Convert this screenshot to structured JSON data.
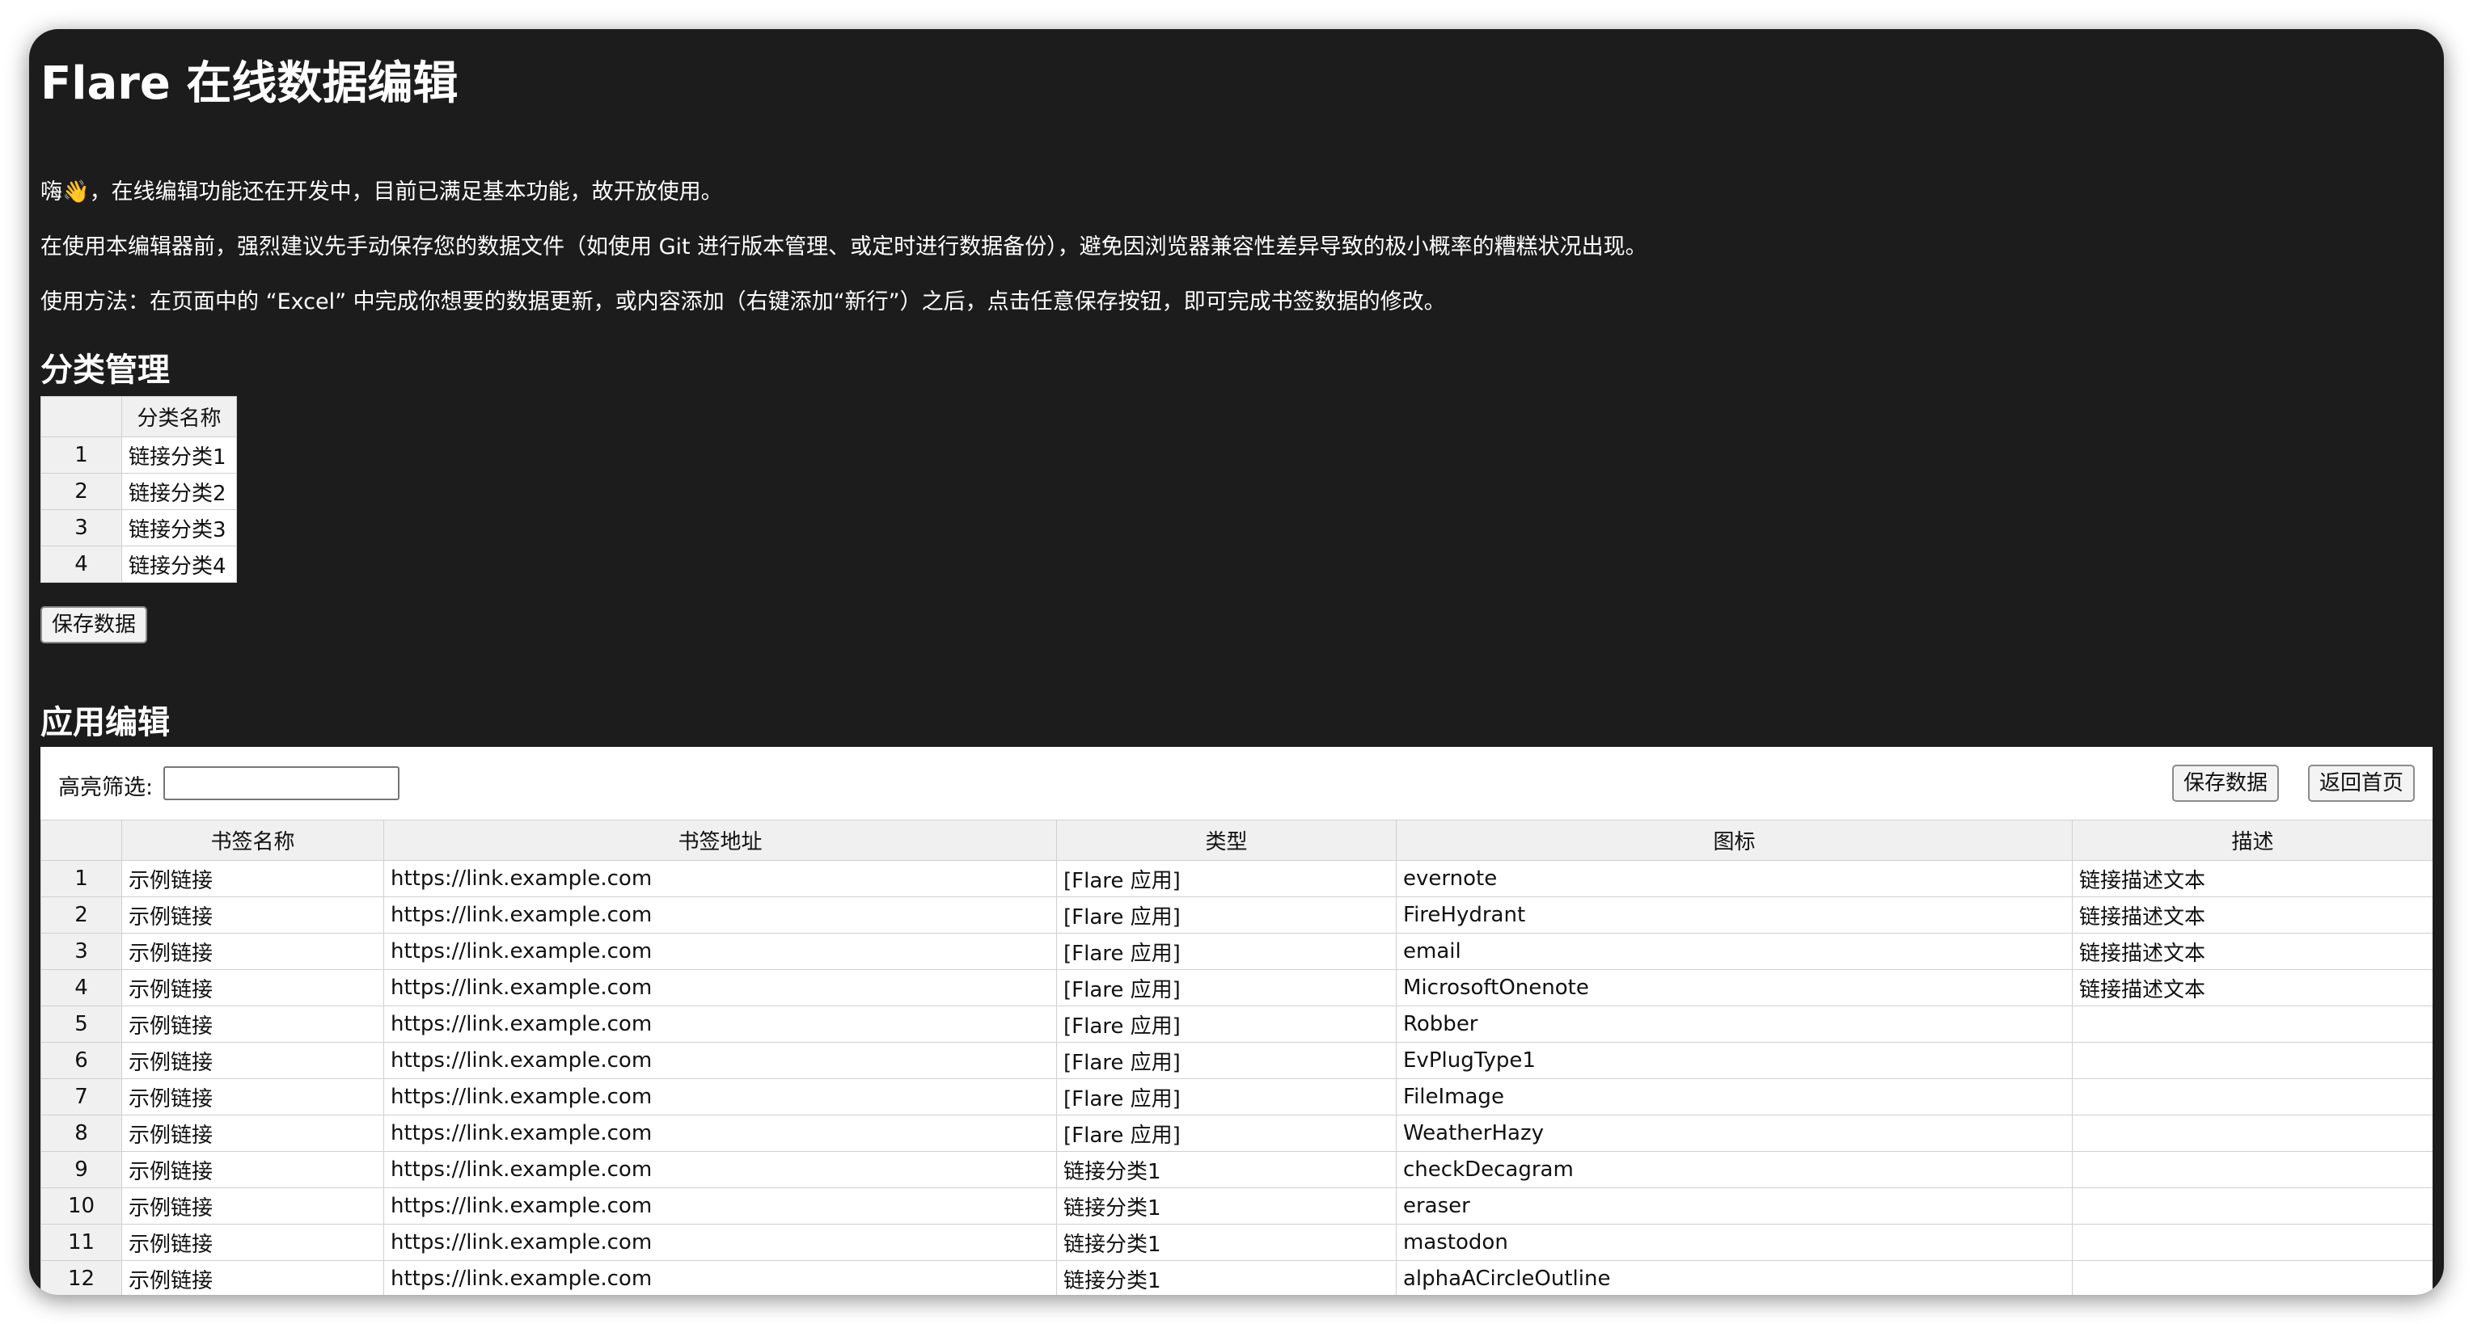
{
  "title": "Flare 在线数据编辑",
  "paragraphs": [
    "嗨👋，在线编辑功能还在开发中，目前已满足基本功能，故开放使用。",
    "在使用本编辑器前，强烈建议先手动保存您的数据文件（如使用 Git 进行版本管理、或定时进行数据备份），避免因浏览器兼容性差异导致的极小概率的糟糕状况出现。",
    "使用方法：在页面中的 “Excel” 中完成你想要的数据更新，或内容添加（右键添加“新行”）之后，点击任意保存按钮，即可完成书签数据的修改。"
  ],
  "categories": {
    "heading": "分类管理",
    "column_header": "分类名称",
    "rows": [
      {
        "num": "1",
        "name": "链接分类1"
      },
      {
        "num": "2",
        "name": "链接分类2"
      },
      {
        "num": "3",
        "name": "链接分类3"
      },
      {
        "num": "4",
        "name": "链接分类4"
      }
    ],
    "save_label": "保存数据"
  },
  "apps": {
    "heading": "应用编辑",
    "filter_label": "高亮筛选:",
    "filter_value": "",
    "save_label": "保存数据",
    "home_label": "返回首页",
    "headers": [
      "书签名称",
      "书签地址",
      "类型",
      "图标",
      "描述"
    ],
    "rows": [
      {
        "num": "1",
        "name": "示例链接",
        "url": "https://link.example.com",
        "type": "[Flare 应用]",
        "icon": "evernote",
        "desc": "链接描述文本"
      },
      {
        "num": "2",
        "name": "示例链接",
        "url": "https://link.example.com",
        "type": "[Flare 应用]",
        "icon": "FireHydrant",
        "desc": "链接描述文本"
      },
      {
        "num": "3",
        "name": "示例链接",
        "url": "https://link.example.com",
        "type": "[Flare 应用]",
        "icon": "email",
        "desc": "链接描述文本"
      },
      {
        "num": "4",
        "name": "示例链接",
        "url": "https://link.example.com",
        "type": "[Flare 应用]",
        "icon": "MicrosoftOnenote",
        "desc": "链接描述文本"
      },
      {
        "num": "5",
        "name": "示例链接",
        "url": "https://link.example.com",
        "type": "[Flare 应用]",
        "icon": "Robber",
        "desc": ""
      },
      {
        "num": "6",
        "name": "示例链接",
        "url": "https://link.example.com",
        "type": "[Flare 应用]",
        "icon": "EvPlugType1",
        "desc": ""
      },
      {
        "num": "7",
        "name": "示例链接",
        "url": "https://link.example.com",
        "type": "[Flare 应用]",
        "icon": "FileImage",
        "desc": ""
      },
      {
        "num": "8",
        "name": "示例链接",
        "url": "https://link.example.com",
        "type": "[Flare 应用]",
        "icon": "WeatherHazy",
        "desc": ""
      },
      {
        "num": "9",
        "name": "示例链接",
        "url": "https://link.example.com",
        "type": "链接分类1",
        "icon": "checkDecagram",
        "desc": ""
      },
      {
        "num": "10",
        "name": "示例链接",
        "url": "https://link.example.com",
        "type": "链接分类1",
        "icon": "eraser",
        "desc": ""
      },
      {
        "num": "11",
        "name": "示例链接",
        "url": "https://link.example.com",
        "type": "链接分类1",
        "icon": "mastodon",
        "desc": ""
      },
      {
        "num": "12",
        "name": "示例链接",
        "url": "https://link.example.com",
        "type": "链接分类1",
        "icon": "alphaACircleOutline",
        "desc": ""
      }
    ]
  }
}
